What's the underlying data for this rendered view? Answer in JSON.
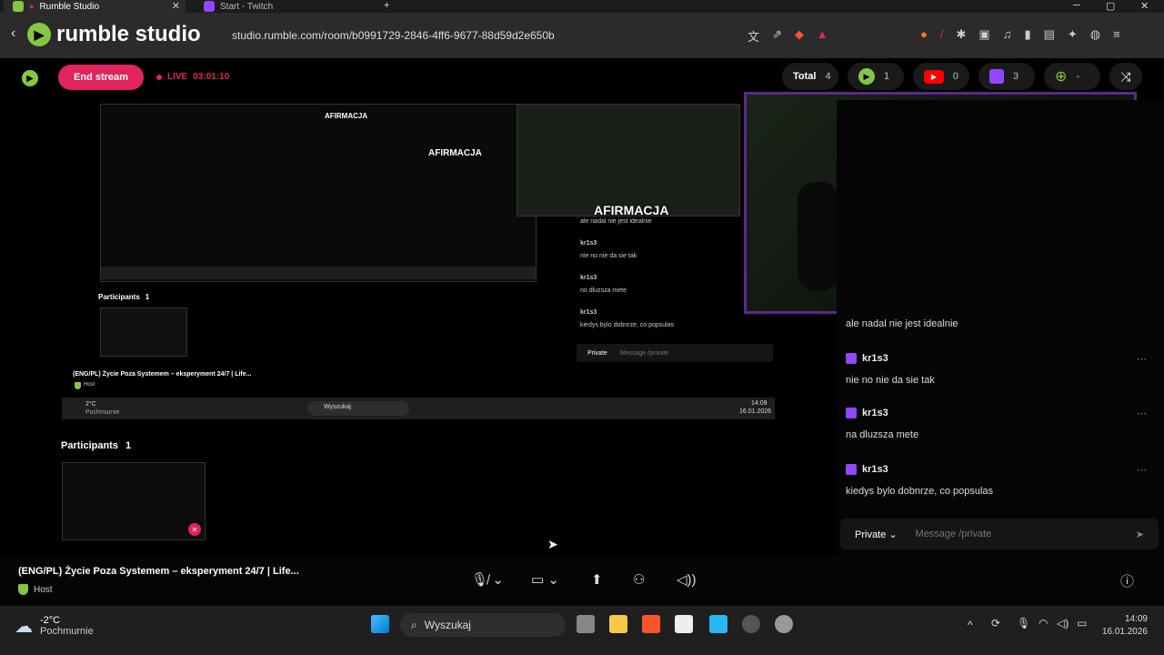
{
  "browser": {
    "tabs": [
      {
        "label": "Rumble Studio",
        "active": true
      },
      {
        "label": "Start - Twitch",
        "active": false
      }
    ],
    "url": "studio.rumble.com/room/b0991729-2846-4ff6-9677-88d59d2e650b"
  },
  "app": {
    "brand": "rumble studio",
    "end_stream_label": "End stream",
    "live_label": "LIVE",
    "live_time": "03:01:10",
    "stats": {
      "total_label": "Total",
      "total": "4",
      "rumble": "1",
      "youtube": "0",
      "twitch": "3",
      "web": "-"
    }
  },
  "stage": {
    "overlay_text": "AFIRMACJA",
    "participants_label": "Participants",
    "participants_count": "1",
    "nested_chat": [
      {
        "user": "",
        "text": "ale nadal nie jest idealnie"
      },
      {
        "user": "kr1s3",
        "text": "nie no nie da sie tak"
      },
      {
        "user": "kr1s3",
        "text": "no dluzsza mete"
      },
      {
        "user": "kr1s3",
        "text": "kiedys bylo dobnrze, co popsulas"
      }
    ],
    "nested_private": "Private",
    "nested_placeholder": "Message /private",
    "nested_title": "(ENG/PL) Życie Poza Systemem – eksperyment 24/7 | Life...",
    "nested_host": "Host",
    "nested_weather_temp": "2°C",
    "nested_weather_desc": "Pochmurnie",
    "nested_search": "Wyszukaj",
    "nested_time": "14:09",
    "nested_date": "16.01.2026"
  },
  "chat": {
    "messages": [
      {
        "user": "",
        "text": "ale nadal nie jest idealnie"
      },
      {
        "user": "kr1s3",
        "text": "nie no nie da sie tak"
      },
      {
        "user": "kr1s3",
        "text": "na dluzsza mete"
      },
      {
        "user": "kr1s3",
        "text": "kiedys bylo dobnrze, co popsulas"
      }
    ],
    "mode": "Private",
    "placeholder": "Message /private"
  },
  "bottom": {
    "title": "(ENG/PL) Życie Poza Systemem – eksperyment 24/7 | Life...",
    "host_label": "Host"
  },
  "taskbar": {
    "temp": "-2°C",
    "weather": "Pochmurnie",
    "search": "Wyszukaj",
    "time": "14:09",
    "date": "16.01.2026"
  },
  "colors": {
    "rumble_green": "#85c742",
    "live_red": "#e0245e",
    "twitch_purple": "#9146ff"
  }
}
